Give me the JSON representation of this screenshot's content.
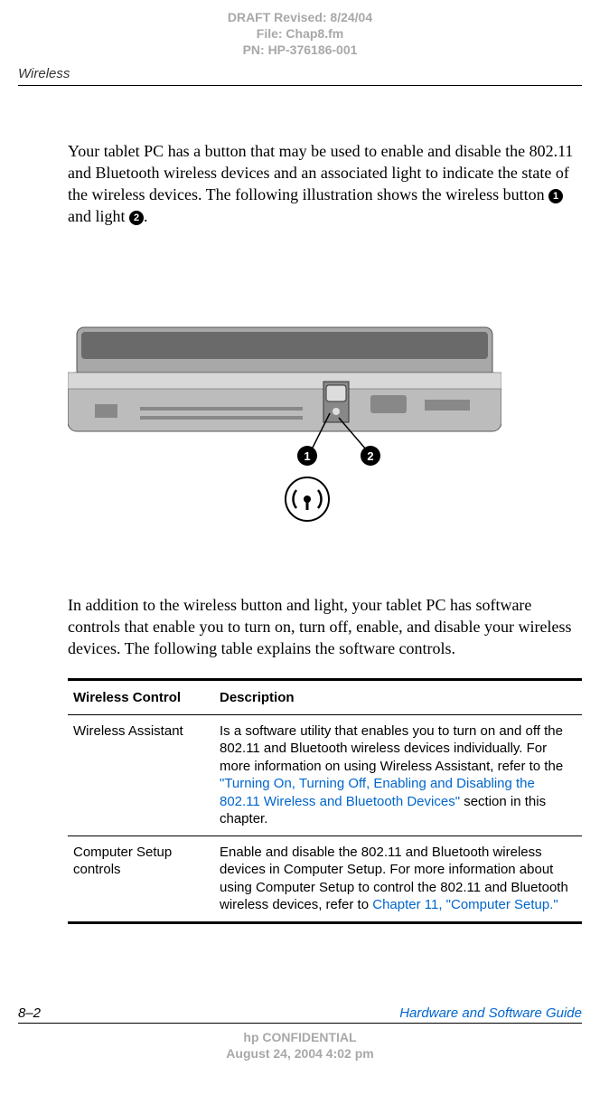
{
  "draft_header": {
    "line1": "DRAFT Revised: 8/24/04",
    "line2": "File: Chap8.fm",
    "line3": "PN: HP-376186-001"
  },
  "running_header": "Wireless",
  "para1_pre": "Your tablet PC has a button that may be used to enable and disable the 802.11 and Bluetooth wireless devices and an associated light to indicate the state of the wireless devices. The following illustration shows the wireless button ",
  "para1_mid": " and light ",
  "para1_post": ".",
  "callout1": "1",
  "callout2": "2",
  "para2": "In addition to the wireless button and light, your tablet PC has software controls that enable you to turn on, turn off, enable, and disable your wireless devices. The following table explains the software controls.",
  "table": {
    "header_control": "Wireless Control",
    "header_desc": "Description",
    "rows": [
      {
        "control": "Wireless Assistant",
        "desc_pre": "Is a software utility that enables you to turn on and off the 802.11 and Bluetooth wireless devices individually. For more information on using Wireless Assistant, refer to the ",
        "desc_link": "\"Turning On, Turning Off, Enabling and Disabling the 802.11 Wireless and Bluetooth Devices\"",
        "desc_post": " section in this chapter."
      },
      {
        "control": "Computer Setup controls",
        "desc_pre": "Enable and disable the 802.11 and Bluetooth wireless devices in Computer Setup. For more information about using Computer Setup to control the 802.11 and Bluetooth wireless devices, refer to ",
        "desc_link": "Chapter 11, \"Computer Setup.\"",
        "desc_post": ""
      }
    ]
  },
  "footer": {
    "page_num": "8–2",
    "guide_title": "Hardware and Software Guide"
  },
  "confidential": {
    "line1": "hp CONFIDENTIAL",
    "line2": "August 24, 2004 4:02 pm"
  }
}
